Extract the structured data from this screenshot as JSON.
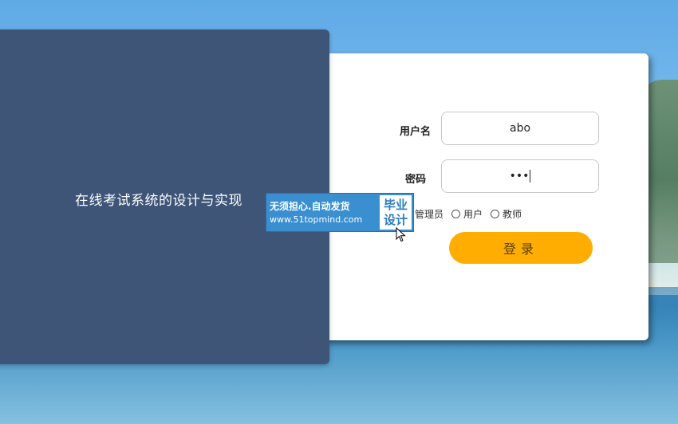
{
  "system": {
    "title": "在线考试系统的设计与实现"
  },
  "login_form": {
    "username_label": "用户名",
    "username_value": "abo",
    "password_label": "密码",
    "password_masked": "•••",
    "roles": [
      {
        "label": "管理员",
        "selected": false
      },
      {
        "label": "用户",
        "selected": false
      },
      {
        "label": "教师",
        "selected": false
      }
    ],
    "submit_label": "登录"
  },
  "watermark": {
    "line1": "无须担心.自动发货",
    "line2": "www.51topmind.com",
    "badge_line1": "毕业",
    "badge_line2": "设计"
  },
  "colors": {
    "left_panel": "#3e5578",
    "login_button": "#ffad00",
    "watermark": "#3a8fd1"
  },
  "icons": [
    "mouse-cursor-icon",
    "radio-icon"
  ]
}
